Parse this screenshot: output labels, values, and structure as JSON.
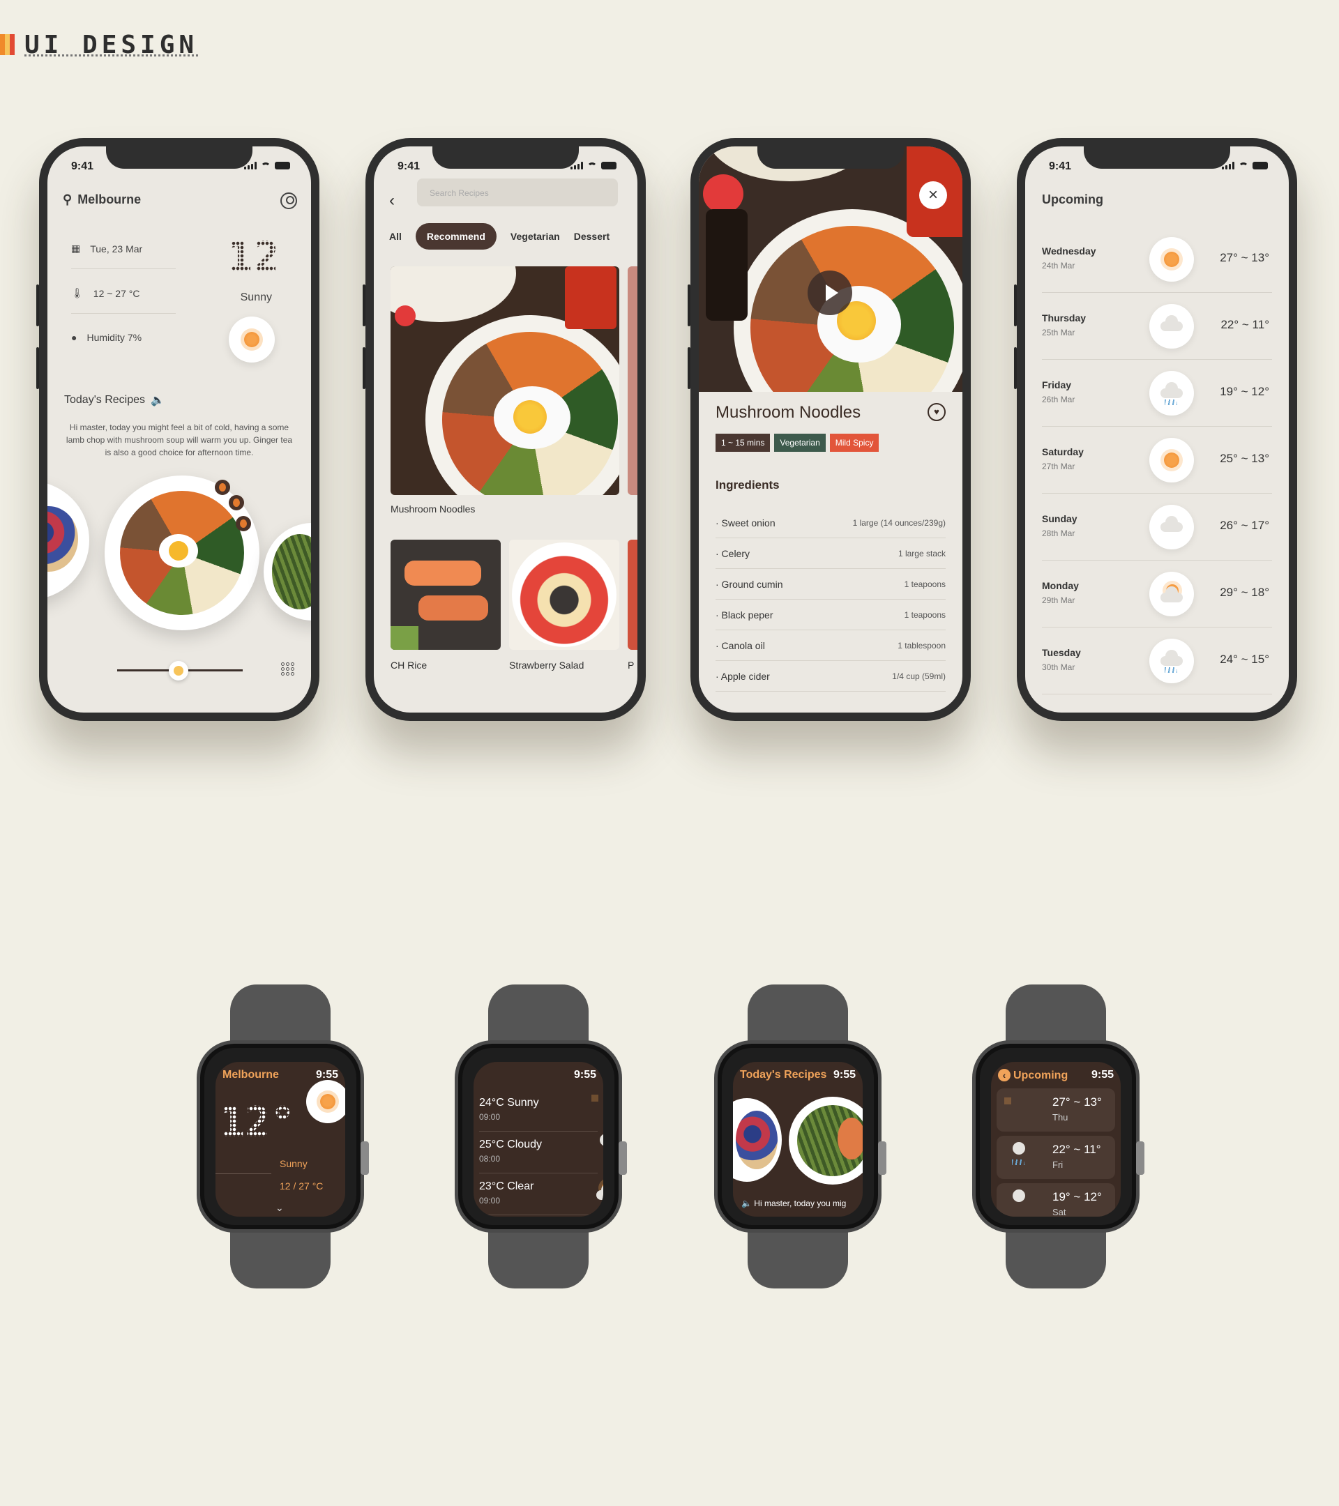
{
  "brand": {
    "title": "UI DESIGN",
    "colors": [
      "#f08a2a",
      "#f7c45a",
      "#e24a33"
    ]
  },
  "status_bar": {
    "time": "9:41"
  },
  "home": {
    "location": "Melbourne",
    "date": "Tue,  23  Mar",
    "temp_range": "12 ~ 27 °C",
    "humidity": "Humidity 7%",
    "big_temp": "12",
    "condition": "Sunny",
    "recipes_heading": "Today's Recipes",
    "recipes_text": "Hi master, today you might feel a bit of cold, having a some lamb chop with mushroom soup will warm you up. Ginger tea is also a good choice for afternoon time."
  },
  "browse": {
    "search_placeholder": "Search Recipes",
    "tabs": [
      "All",
      "Recommend",
      "Vegetarian",
      "Dessert"
    ],
    "active_tab": "Recommend",
    "featured_label": "Mushroom  Noodles",
    "items": [
      "CH Rice",
      "Strawberry Salad",
      "P"
    ]
  },
  "detail": {
    "title": "Mushroom Noodles",
    "chips": [
      {
        "label": "1 ~ 15 mins",
        "color": "#4a3731"
      },
      {
        "label": "Vegetarian",
        "color": "#3d5a4c"
      },
      {
        "label": "Mild Spicy",
        "color": "#e2553a"
      }
    ],
    "ingredients_heading": "Ingredients",
    "ingredients": [
      {
        "name": "· Sweet onion",
        "qty": "1 large (14 ounces/239g)"
      },
      {
        "name": "· Celery",
        "qty": "1 large stack"
      },
      {
        "name": "· Ground cumin",
        "qty": "1 teapoons"
      },
      {
        "name": "· Black peper",
        "qty": "1 teapoons"
      },
      {
        "name": "· Canola oil",
        "qty": "1 tablespoon"
      },
      {
        "name": "· Apple cider",
        "qty": "1/4 cup (59ml)"
      }
    ]
  },
  "upcoming": {
    "heading": "Upcoming",
    "days": [
      {
        "day": "Wednesday",
        "date": "24th Mar",
        "icon": "sun-icon",
        "temp": "27° ~ 13°"
      },
      {
        "day": "Thursday",
        "date": "25th Mar",
        "icon": "cloud-icon",
        "temp": "22° ~ 11°"
      },
      {
        "day": "Friday",
        "date": "26th Mar",
        "icon": "rain-icon",
        "temp": "19° ~ 12°"
      },
      {
        "day": "Saturday",
        "date": "27th Mar",
        "icon": "sun-icon",
        "temp": "25° ~ 13°"
      },
      {
        "day": "Sunday",
        "date": "28th Mar",
        "icon": "cloud-icon",
        "temp": "26° ~ 17°"
      },
      {
        "day": "Monday",
        "date": "29th Mar",
        "icon": "partly-cloudy-icon",
        "temp": "29° ~ 18°"
      },
      {
        "day": "Tuesday",
        "date": "30th Mar",
        "icon": "rain-icon",
        "temp": "24° ~ 15°"
      }
    ]
  },
  "watch": {
    "time": "9:55",
    "w1": {
      "title": "Melbourne",
      "big_temp": "12°",
      "condition": "Sunny",
      "range": "12 / 27 °C"
    },
    "w2": {
      "items": [
        {
          "text": "24°C  Sunny",
          "hour": "09:00",
          "icon": "sun-icon"
        },
        {
          "text": "25°C  Cloudy",
          "hour": "08:00",
          "icon": "cloud-icon"
        },
        {
          "text": "23°C  Clear",
          "hour": "09:00",
          "icon": "partly-cloudy-icon"
        }
      ]
    },
    "w3": {
      "title": "Today's Recipes",
      "text": "Hi master, today you mig"
    },
    "w4": {
      "title": "Upcoming",
      "items": [
        {
          "temp": "27° ~ 13°",
          "day": "Thu",
          "icon": "sun-icon"
        },
        {
          "temp": "22° ~ 11°",
          "day": "Fri",
          "icon": "rain-icon"
        },
        {
          "temp": "19° ~ 12°",
          "day": "Sat",
          "icon": "cloud-icon"
        }
      ]
    }
  }
}
